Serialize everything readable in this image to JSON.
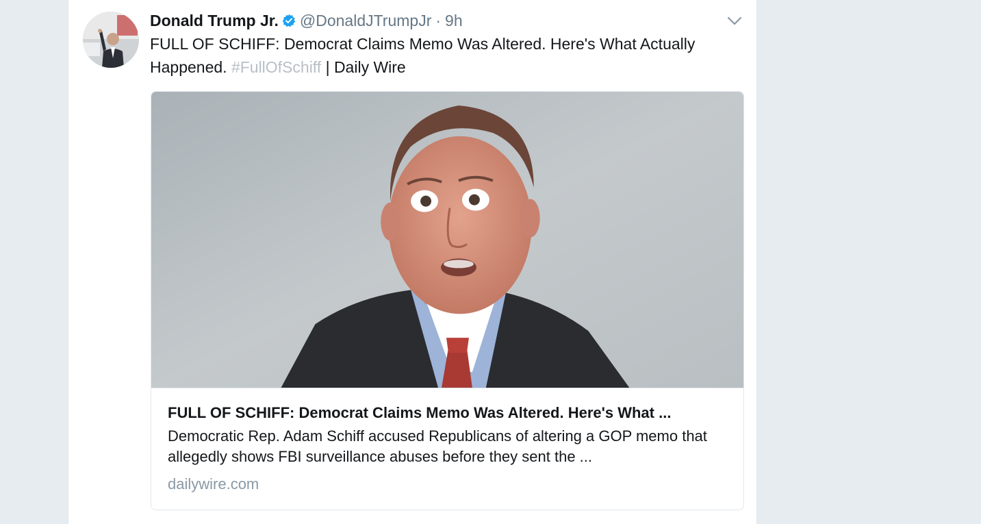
{
  "tweet": {
    "author": {
      "display_name": "Donald Trump Jr.",
      "screen_name": "@DonaldJTrumpJr",
      "verified": true
    },
    "separator": "·",
    "timestamp": "9h",
    "text_part1": "FULL OF SCHIFF: Democrat Claims Memo Was Altered. Here's What Actually Happened. ",
    "hashtag": "#FullOfSchiff",
    "text_part2": " | Daily Wire"
  },
  "card": {
    "title": "FULL OF SCHIFF: Democrat Claims Memo Was Altered. Here's What ...",
    "description": "Democratic Rep. Adam Schiff accused Republicans of altering a GOP memo that allegedly shows FBI surveillance abuses before they sent the ...",
    "domain": "dailywire.com"
  },
  "colors": {
    "background": "#e6ecf0",
    "text": "#14171a",
    "secondary": "#657786",
    "hashtag": "#b7bfc6",
    "verified": "#1da1f2",
    "domain": "#8899a6"
  },
  "icons": {
    "verified": "verified-badge-icon",
    "caret": "chevron-down-icon"
  }
}
